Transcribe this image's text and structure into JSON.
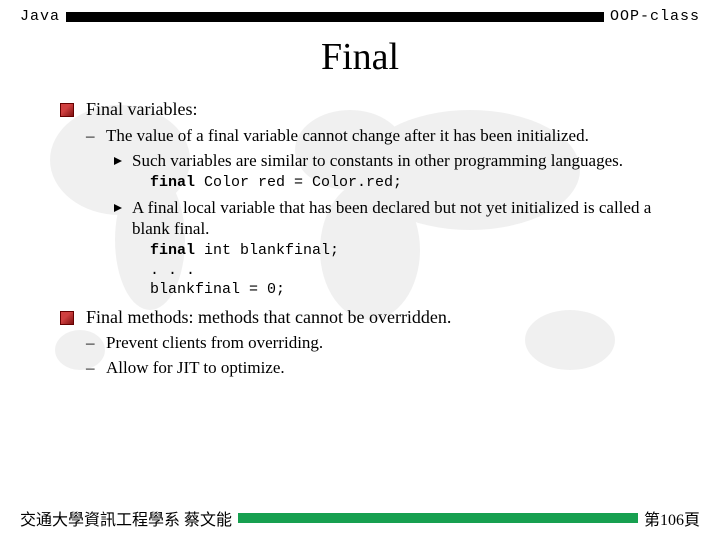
{
  "header": {
    "left": "Java",
    "right": "OOP-class"
  },
  "title": "Final",
  "b1": "Final variables:",
  "b1_sub1": "The value of a final variable cannot change after it has been initialized.",
  "b1_sub1_a": "Such variables are similar to constants in other programming languages.",
  "code1_kw": "final",
  "code1_rest": " Color red = Color.red;",
  "b1_sub1_b": "A final local variable that has been declared but not yet initialized is called a blank final.",
  "code2_kw": "final",
  "code2_rest": " int blankfinal;\n. . .\nblankfinal = 0;",
  "b2": "Final methods: methods that cannot be overridden.",
  "b2_sub1": "Prevent clients from overriding.",
  "b2_sub2": "Allow for JIT to optimize.",
  "footer": {
    "left": "交通大學資訊工程學系 蔡文能",
    "right": "第106頁"
  }
}
